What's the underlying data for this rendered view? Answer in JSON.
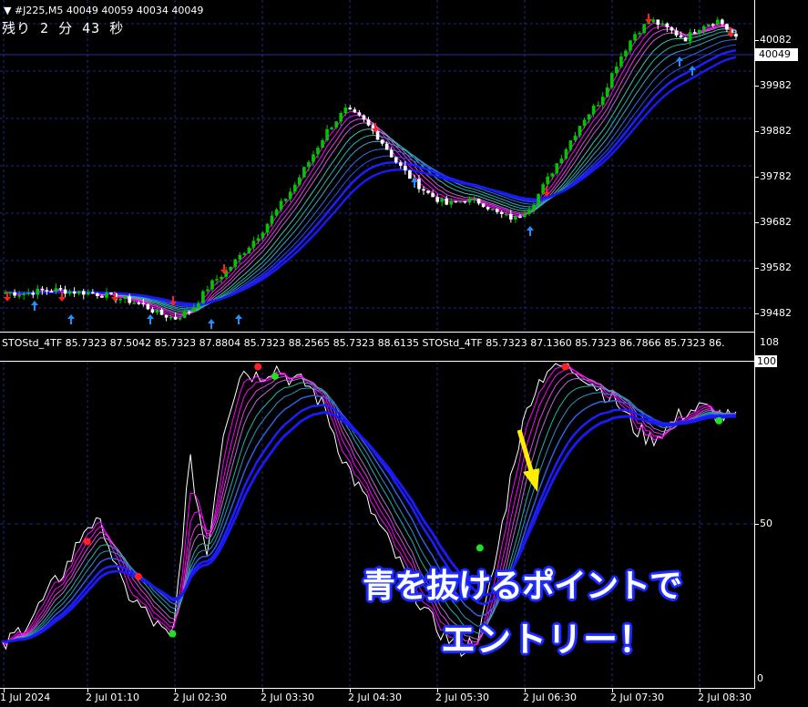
{
  "chart_header": {
    "symbol_info": "#J225,M5  40049 40059 40034 40049",
    "countdown": "残り 2 分 43 秒"
  },
  "price_axis": {
    "labels": [
      "40082",
      "39982",
      "39882",
      "39782",
      "39682",
      "39582",
      "39482"
    ],
    "current_price": "40049"
  },
  "indicator": {
    "header": "STOStd_4TF 85.7323 87.5042 85.7323 87.8804 85.7323 88.2565 85.7323 88.6135  STOStd_4TF 85.7323 87.1360 85.7323 86.7866 85.7323 86.",
    "axis_max_label": "100",
    "axis_top_label": "108",
    "axis_mid_label": "50",
    "axis_bottom_label": "0"
  },
  "time_axis": {
    "labels": [
      "1 Jul 2024",
      "2 Jul 01:10",
      "2 Jul 02:30",
      "2 Jul 03:30",
      "2 Jul 04:30",
      "2 Jul 05:30",
      "2 Jul 06:30",
      "2 Jul 07:30",
      "2 Jul 08:30"
    ]
  },
  "annotation": {
    "line1": "青を抜けるポイントで",
    "line2": "エントリー！"
  },
  "colors": {
    "bull_candle": "#00c800",
    "bear_candle": "#ffffff",
    "up_arrow": "#1e90ff",
    "down_arrow": "#ff2020",
    "ma_fast": "#ff00ff",
    "ma_mid": "#20b2aa",
    "ma_slow": "#1e1eff",
    "grid": "#1a2a8a",
    "callout_arrow": "#ffee00",
    "callout_stroke": "#1826ff"
  },
  "chart_data": [
    {
      "type": "candlestick",
      "title": "#J225,M5",
      "x": [
        "1 Jul 2024",
        "2 Jul 01:10",
        "2 Jul 02:30",
        "2 Jul 03:30",
        "2 Jul 04:30",
        "2 Jul 05:30",
        "2 Jul 06:30",
        "2 Jul 07:30",
        "2 Jul 08:30"
      ],
      "close_trace": [
        39515,
        39512,
        39518,
        39520,
        39516,
        39514,
        39508,
        39500,
        39490,
        39470,
        39460,
        39480,
        39530,
        39560,
        39600,
        39640,
        39690,
        39740,
        39800,
        39860,
        39900,
        39880,
        39840,
        39790,
        39750,
        39720,
        39700,
        39710,
        39705,
        39680,
        39670,
        39700,
        39760,
        39820,
        39880,
        39920,
        40000,
        40060,
        40090,
        40070,
        40050,
        40080,
        40090,
        40049
      ],
      "ylim": [
        39432,
        40132
      ],
      "yticks": [
        39482,
        39582,
        39682,
        39782,
        39882,
        39982,
        40082
      ],
      "current": 40049
    },
    {
      "type": "line",
      "title": "STOStd_4TF",
      "ylim": [
        0,
        100
      ],
      "yticks": [
        0,
        50,
        100
      ],
      "stochastic_trace": [
        10,
        16,
        22,
        30,
        38,
        50,
        48,
        30,
        24,
        18,
        12,
        70,
        40,
        80,
        98,
        96,
        99,
        95,
        93,
        85,
        70,
        60,
        50,
        40,
        30,
        20,
        14,
        10,
        15,
        40,
        70,
        90,
        99,
        99,
        97,
        92,
        88,
        80,
        76,
        80,
        85,
        86,
        84,
        82
      ],
      "buy_signal_markers": [
        [
          10,
          15
        ],
        [
          16,
          96
        ],
        [
          28,
          42
        ],
        [
          42,
          82
        ]
      ],
      "sell_signal_markers": [
        [
          5,
          44
        ],
        [
          8,
          33
        ],
        [
          15,
          99
        ],
        [
          33,
          99
        ]
      ]
    }
  ]
}
